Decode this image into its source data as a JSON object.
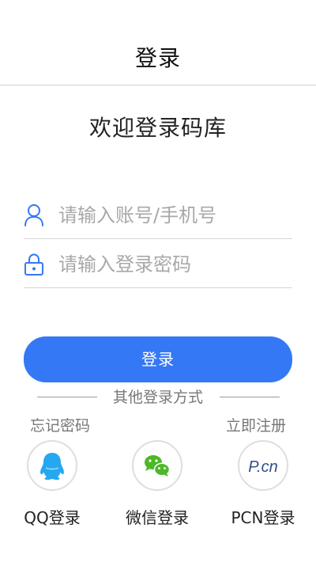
{
  "header": {
    "title": "登录"
  },
  "welcome": "欢迎登录码库",
  "form": {
    "username": {
      "placeholder": "请输入账号/手机号",
      "value": ""
    },
    "password": {
      "placeholder": "请输入登录密码",
      "value": ""
    }
  },
  "login_button": "登录",
  "divider_text": "其他登录方式",
  "forgot_password": "忘记密码",
  "register": "立即注册",
  "social": [
    {
      "label": "QQ登录",
      "icon": "qq-icon"
    },
    {
      "label": "微信登录",
      "icon": "wechat-icon"
    },
    {
      "label": "PCN登录",
      "icon": "pcn-icon",
      "icon_text": "P.cn"
    }
  ],
  "colors": {
    "accent": "#3478f6",
    "qq": "#25a8ef",
    "wechat": "#4cb82a",
    "pcn": "#2b4f8c"
  }
}
